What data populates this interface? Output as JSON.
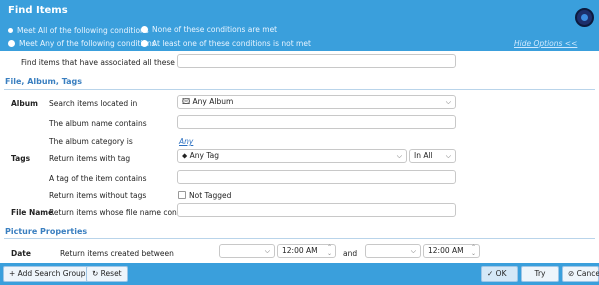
{
  "header": {
    "title": "Find Items",
    "options": [
      {
        "label": "Meet All of the following conditions",
        "selected": true
      },
      {
        "label": "None of these conditions are met",
        "selected": false
      },
      {
        "label": "Meet Any of the following conditions",
        "selected": false
      },
      {
        "label": "At least one of these conditions is not met",
        "selected": false
      }
    ],
    "hide_options": "Hide Options <<"
  },
  "keywords": {
    "label": "Find items that have associated all these words:",
    "value": ""
  },
  "sections": {
    "file_album_tags": "File, Album, Tags",
    "picture_properties": "Picture Properties"
  },
  "album": {
    "group": "Album",
    "located_label": "Search items located in",
    "located_value": "Any Album",
    "name_label": "The album name contains",
    "category_label": "The album category is",
    "category_value": "Any"
  },
  "tags": {
    "group": "Tags",
    "with_tag_label": "Return items with tag",
    "with_tag_value": "Any Tag",
    "scope_value": "In All",
    "tag_contains_label": "A tag of the item contains",
    "without_tags_label": "Return items without tags",
    "not_tagged_label": "Not Tagged"
  },
  "file_name": {
    "group": "File Name",
    "label": "Return items whose file name contains"
  },
  "date": {
    "group": "Date",
    "label": "Return items created between",
    "from_time": "12:00 AM",
    "and_label": "and",
    "to_time": "12:00 AM"
  },
  "footer": {
    "add_group": "+ Add Search Group",
    "reset": "Reset",
    "ok": "OK",
    "try": "Try",
    "cancel": "Cancel"
  },
  "colors": {
    "accent": "#3a9fdc",
    "section": "#3a7fc0"
  }
}
